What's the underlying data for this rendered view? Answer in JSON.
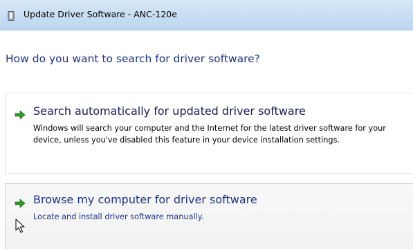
{
  "window": {
    "title": "Update Driver Software - ANC-120e",
    "title_icon": "device-icon"
  },
  "main": {
    "heading": "How do you want to search for driver software?"
  },
  "options": [
    {
      "icon": "green-arrow-icon",
      "title": "Search automatically for updated driver software",
      "description": "Windows will search your computer and the Internet for the latest driver software for your device, unless you've disabled this feature in your device installation settings."
    },
    {
      "icon": "green-arrow-icon",
      "title": "Browse my computer for driver software",
      "description": "Locate and install driver software manually."
    }
  ],
  "colors": {
    "titlebar": "#c7def3",
    "heading_blue": "#1e3287",
    "arrow_green": "#2f9a2a"
  },
  "cursor": "mouse-pointer-icon"
}
